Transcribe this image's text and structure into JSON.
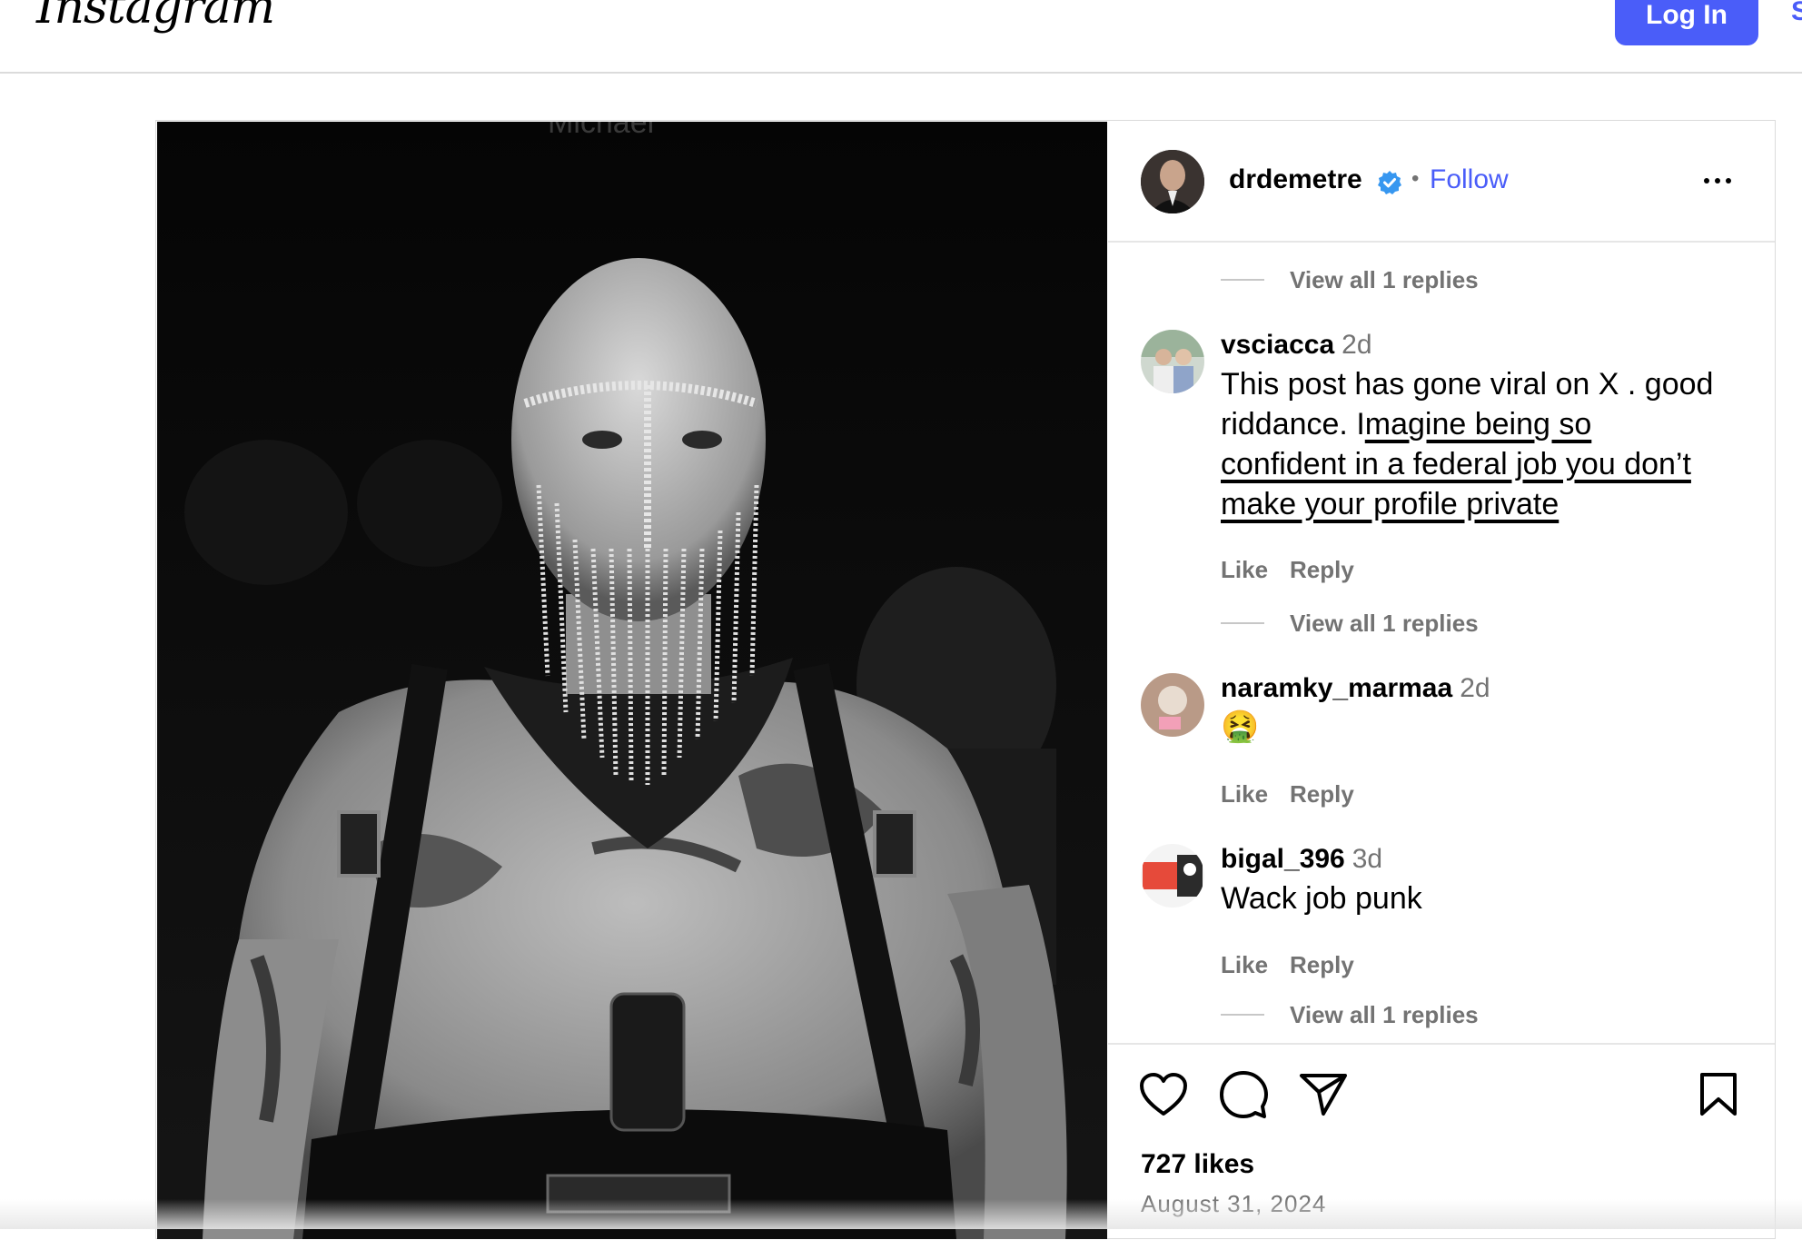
{
  "topbar": {
    "logo": "Instagram",
    "login_label": "Log In",
    "signup_label": "S"
  },
  "post": {
    "author": "drdemetre",
    "follow_label": "Follow",
    "separator": "•",
    "photo_caption_fragment": "Michael",
    "comments": [
      {
        "type": "replies",
        "label": "View all 1 replies"
      },
      {
        "type": "comment",
        "user": "vsciacca",
        "time": "2d",
        "text_line1": "This post has gone viral on X . good",
        "text_line2_plain": "riddance. I",
        "text_line2_marked": "magine being so",
        "text_line3": "confident in a federal job you don’t",
        "text_line4": "make your profile private",
        "like": "Like",
        "reply": "Reply"
      },
      {
        "type": "replies",
        "label": "View all 1 replies"
      },
      {
        "type": "comment",
        "user": "naramky_marmaa",
        "time": "2d",
        "text": "🤮",
        "like": "Like",
        "reply": "Reply"
      },
      {
        "type": "comment",
        "user": "bigal_396",
        "time": "3d",
        "text": "Wack job punk",
        "like": "Like",
        "reply": "Reply"
      },
      {
        "type": "replies",
        "label": "View all 1 replies"
      }
    ],
    "likes": "727 likes",
    "date": "August 31, 2024"
  },
  "icons": {
    "verified": "verified-badge-icon",
    "more": "more-options-icon",
    "like": "heart-icon",
    "comment": "comment-icon",
    "share": "share-icon",
    "save": "bookmark-icon"
  },
  "colors": {
    "accent": "#4a5df9",
    "verified": "#3797f0",
    "muted": "#737373",
    "border": "#dbdbdb"
  }
}
